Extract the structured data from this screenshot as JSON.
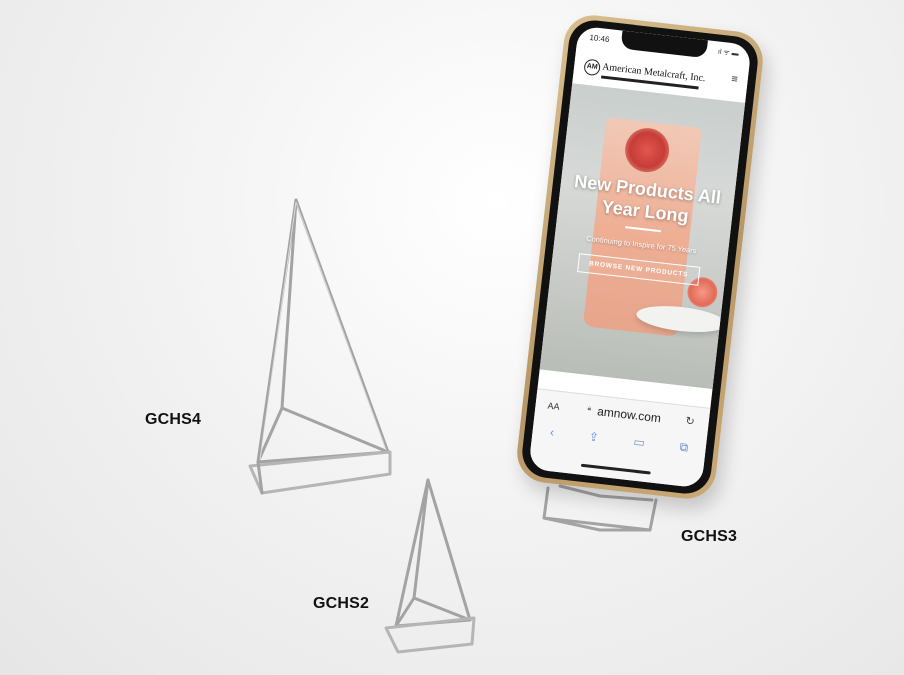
{
  "product_labels": {
    "large": "GCHS4",
    "medium": "GCHS3",
    "small": "GCHS2"
  },
  "phone": {
    "status_time": "10:46",
    "status_icons": "ıl ᯤ ▬",
    "site": {
      "logo_mark": "AM",
      "logo_text": "American Metalcraft, Inc.",
      "menu_icon": "menu-icon"
    },
    "hero": {
      "title": "New Products All Year Long",
      "subtitle": "Continuing to Inspire for 75 Years",
      "button_label": "BROWSE NEW PRODUCTS"
    },
    "browser": {
      "text_size_label": "AA",
      "url": "amnow.com"
    }
  },
  "colors": {
    "phone_frame": "#c9a876",
    "label_text": "#111111",
    "wire": "#9a9a9a"
  }
}
